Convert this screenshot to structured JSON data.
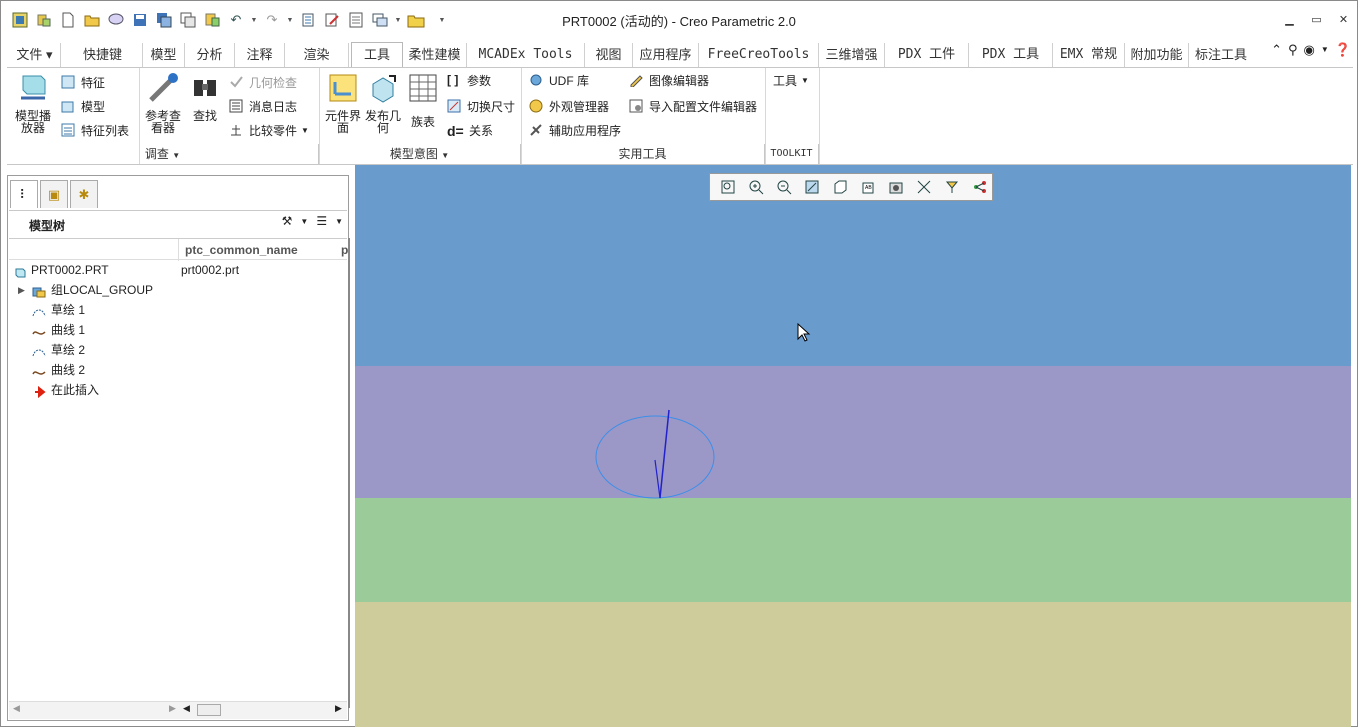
{
  "window": {
    "title": "PRT0002 (活动的) - Creo Parametric 2.0"
  },
  "quick_access": [
    "new-icon",
    "open-icon",
    "save-icon",
    "undo-icon",
    "redo-icon",
    "regenerate-icon",
    "window-icon",
    "close-icon"
  ],
  "tabs": [
    {
      "label": "文件 ▾"
    },
    {
      "label": "快捷键"
    },
    {
      "label": "模型"
    },
    {
      "label": "分析"
    },
    {
      "label": "注释"
    },
    {
      "label": "渲染"
    },
    {
      "label": "工具"
    },
    {
      "label": "柔性建模"
    },
    {
      "label": "MCADEx Tools"
    },
    {
      "label": "视图"
    },
    {
      "label": "应用程序"
    },
    {
      "label": "FreeCreoTools"
    },
    {
      "label": "三维增强"
    },
    {
      "label": "PDX 工件"
    },
    {
      "label": "PDX 工具"
    },
    {
      "label": "EMX 常规"
    },
    {
      "label": "附加功能"
    },
    {
      "label": "标注工具"
    }
  ],
  "ribbon": {
    "model_player": "模型播放器",
    "feature": "特征",
    "model": "模型",
    "feature_list": "特征列表",
    "reference_viewer": "参考查看器",
    "find": "查找",
    "geometry_check": "几何检查",
    "message_log": "消息日志",
    "compare_parts": "比较零件",
    "component_interface": "元件界面",
    "publish_geometry": "发布几何",
    "family_table": "族表",
    "parameters": "参数",
    "switch_dimensions": "切换尺寸",
    "relations": "关系",
    "udf_library": "UDF 库",
    "appearance_manager": "外观管理器",
    "auxiliary_apps": "辅助应用程序",
    "image_editor": "图像编辑器",
    "import_config_editor": "导入配置文件编辑器",
    "tools_drop": "工具",
    "groups": {
      "investigate": "调查",
      "model_intent": "模型意图",
      "utilities": "实用工具",
      "toolkit": "TOOLKIT"
    }
  },
  "model_tree": {
    "title": "模型树",
    "columns": [
      "ptc_common_name",
      "p"
    ],
    "rows": [
      {
        "label": "PRT0002.PRT",
        "value": "prt0002.prt",
        "icon": "part-icon"
      },
      {
        "label": "组LOCAL_GROUP",
        "value": "",
        "icon": "group-icon"
      },
      {
        "label": "草绘 1",
        "value": "",
        "icon": "sketch-icon"
      },
      {
        "label": "曲线 1",
        "value": "",
        "icon": "curve-icon"
      },
      {
        "label": "草绘 2",
        "value": "",
        "icon": "sketch-icon"
      },
      {
        "label": "曲线 2",
        "value": "",
        "icon": "curve-icon"
      },
      {
        "label": "在此插入",
        "value": "",
        "icon": "insert-here-icon"
      }
    ]
  },
  "viewport": {
    "band_colors": [
      "#6a9bcd",
      "#9b98c8",
      "#9bcb98",
      "#cdcc9a"
    ],
    "sketch_color": "#4a86e8",
    "line_color": "#2222cc"
  }
}
